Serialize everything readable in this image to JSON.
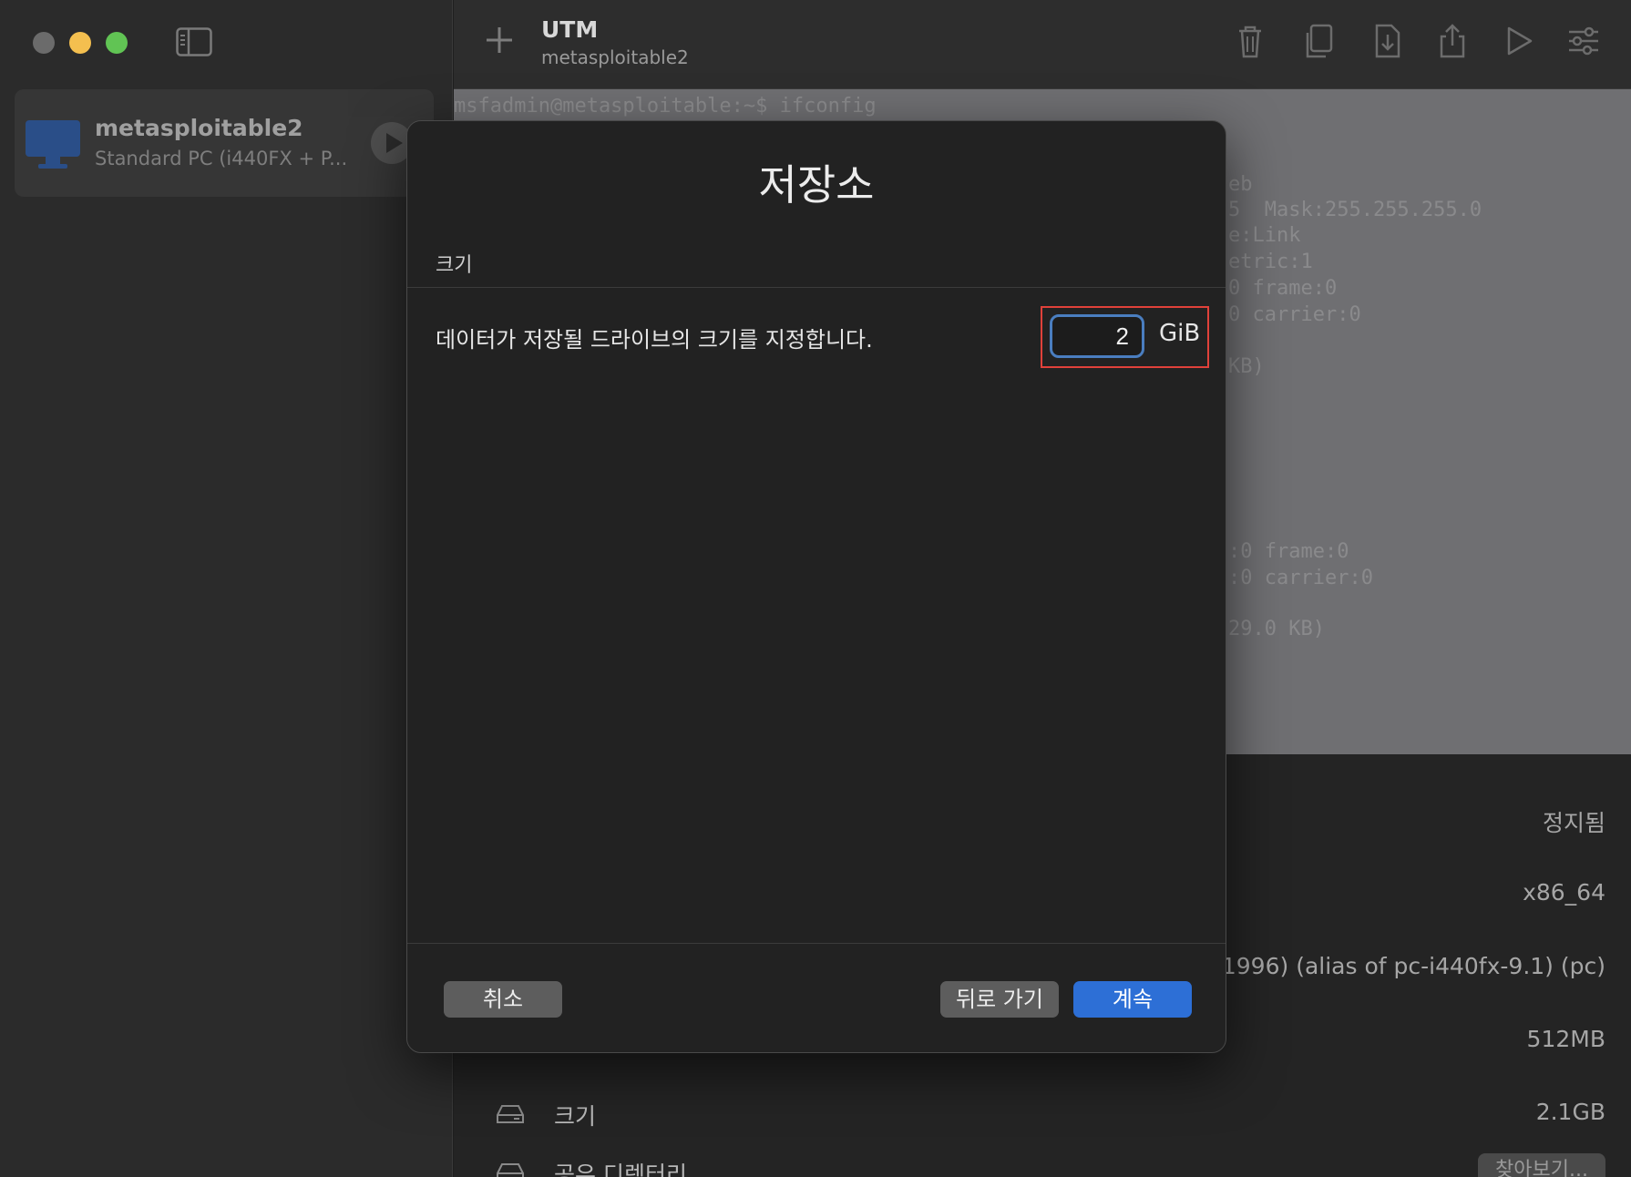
{
  "window": {
    "traffic_lights": [
      "close",
      "minimize",
      "maximize"
    ]
  },
  "sidebar": {
    "vm": {
      "name": "metasploitable2",
      "description": "Standard PC (i440FX + P..."
    }
  },
  "toolbar": {
    "title": "UTM",
    "subtitle": "metasploitable2",
    "icons": [
      "add-icon",
      "trash-icon",
      "clone-icon",
      "download-icon",
      "share-icon",
      "play-icon",
      "settings-icon"
    ]
  },
  "console": {
    "lines": [
      "msfadmin@metasploitable:~$ ifconfig",
      "eb",
      "5  Mask:255.255.255.0",
      "e:Link",
      "etric:1",
      "0 frame:0",
      "0 carrier:0",
      "KB)",
      ":0 frame:0",
      ":0 carrier:0",
      "29.0 KB)"
    ]
  },
  "details": {
    "status": "정지됨",
    "architecture": "x86_64",
    "machine": "1996) (alias of pc-i440fx-9.1) (pc)",
    "memory": "512MB",
    "size_label": "크기",
    "size_value": "2.1GB",
    "shared_dir_label": "공유 디렉터리",
    "browse_label": "찾아보기..."
  },
  "modal": {
    "title": "저장소",
    "section": "크기",
    "description": "데이터가 저장될 드라이브의 크기를 지정합니다.",
    "size_value": "2",
    "size_unit": "GiB",
    "cancel_label": "취소",
    "back_label": "뒤로 가기",
    "continue_label": "계속"
  },
  "colors": {
    "accent": "#2d6fd6",
    "highlight": "#e0413a",
    "input_focus": "#4a7ec0"
  }
}
